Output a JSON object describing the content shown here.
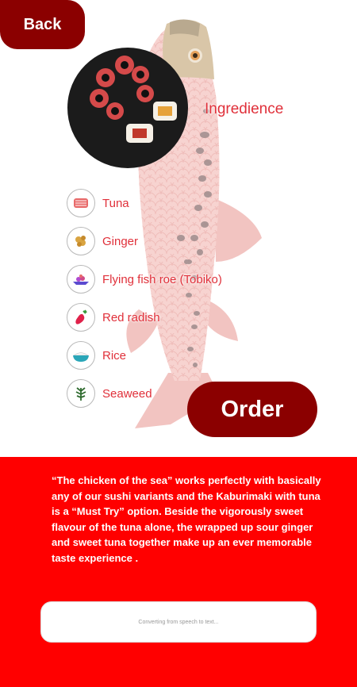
{
  "nav": {
    "back_label": "Back"
  },
  "dish": {
    "image_icon": "sushi-plate-image"
  },
  "ingredients": {
    "title": "Ingredience",
    "items": [
      {
        "label": "Tuna",
        "icon": "tuna-icon"
      },
      {
        "label": "Ginger",
        "icon": "ginger-icon"
      },
      {
        "label": "Flying fish roe (Tobiko)",
        "icon": "fish-roe-icon"
      },
      {
        "label": "Red radish",
        "icon": "radish-icon"
      },
      {
        "label": "Rice",
        "icon": "rice-bowl-icon"
      },
      {
        "label": "Seaweed",
        "icon": "seaweed-icon"
      }
    ]
  },
  "actions": {
    "order_label": "Order"
  },
  "description": "“The chicken of the sea” works perfectly with basically any of our sushi variants and the Kaburimaki with tuna is a “Must Try” option. Beside the vigorously sweet flavour of the tuna alone, the wrapped up sour ginger and sweet tuna together make up an ever memorable taste experience .",
  "speech": {
    "status": "Converting from speech to text..."
  },
  "colors": {
    "primary": "#8b0000",
    "accent": "#ff0000",
    "label": "#e0303a",
    "fish": "#f3c9c6"
  }
}
